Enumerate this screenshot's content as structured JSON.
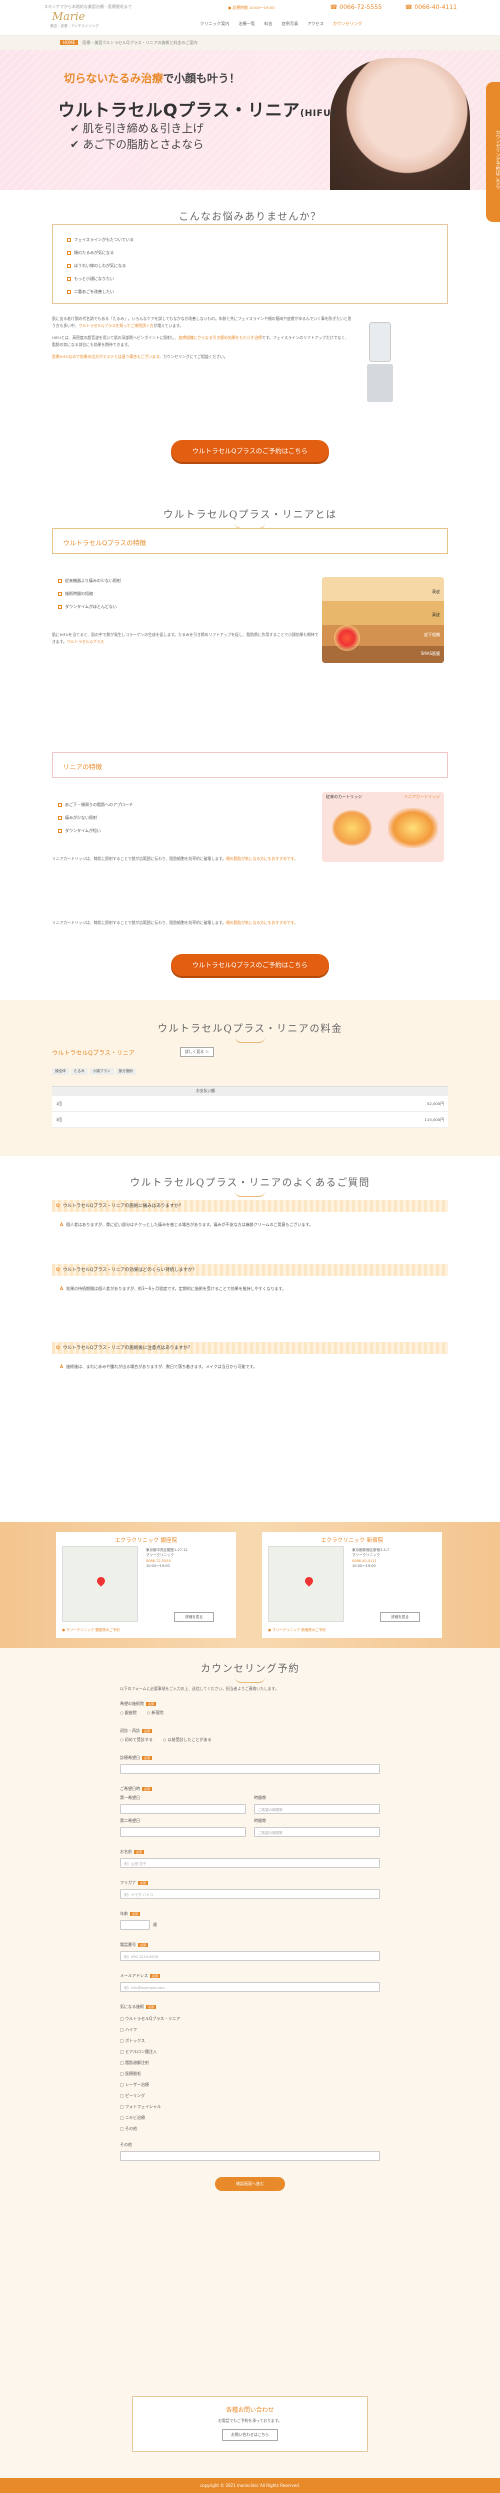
{
  "header": {
    "tagline": "スキンケアから本格的な美容治療・医療脱毛まで",
    "logo": "Marie",
    "logo_sub": "美容・皮膚・アンチエイジング",
    "hours": "● 診療時間 10:00〜19:00",
    "tel1": "☎ 0066-72-5555",
    "tel2": "☎ 0066-40-4111",
    "nav": [
      "クリニック案内",
      "治療一覧",
      "料金",
      "症例写真",
      "アクセス",
      "カウンセリング"
    ]
  },
  "breadcrumb": {
    "home": "HOME",
    "current": "医療・美容ウルトラセルQプラス・リニアの施術と料金のご案内"
  },
  "hero": {
    "line1a": "切らないたるみ治療",
    "line1b": "で小顔も叶う！",
    "title": "ウルトラセルQプラス・リニア",
    "title_suffix": "(HIFU)",
    "point1": "✔ 肌を引き締め＆引き上げ",
    "point2": "✔ あご下の脂肪とさよなら"
  },
  "side_tab": "カウンセリング予約はこちら",
  "worries": {
    "title": "こんなお悩みありませんか？",
    "items": [
      "フェイスラインがもたついている",
      "頬のたるみが気になる",
      "ほうれい線のしわが気になる",
      "もっと小顔になりたい",
      "二重あごを改善したい"
    ]
  },
  "intro": {
    "p1": "肌に出る老け顔の代名詞でもある「たるみ」。いろんなケアを試してもなかなか改善しないもの。年齢と共にフェイスラインや頬の筋肉や皮膚がゆるんでいく事を防ぎたいと思う方も多い中、",
    "p1o": "ウルトラセルQプラスを知ってご来院頂く方",
    "p1e": "が増えています。",
    "p2": "HIFUとは、高密度の超音波を用いて肌の深部層へピンポイントに照射し、",
    "p2o": "皮膚組織にさらなる引き締め効果をもたらす治療",
    "p2e": "です。",
    "p3": "フェイスラインのリフトアップだけでなく、脂肪の気になる部位にも効果を期待できます。",
    "p4o": "医療HIFUなので効果の出方がエステとは違う場合もございます。",
    "p4e": "カウンセリングにてご相談ください。"
  },
  "cta": "ウルトラセルQプラスのご予約はこちら",
  "about": {
    "title": "ウルトラセルQプラス・リニアとは",
    "feature1": "ウルトラセルQプラスの特徴",
    "f1items": [
      "従来機器より痛みの少ない照射",
      "施術時間の短縮",
      "ダウンタイムがほとんどない"
    ],
    "f1text": "肌にHIFUを当てると、肌の中で熱が発生しコラーゲンの生成を促します。たるみを引き締めリフトアップを促し、脂肪層に作用することで小顔効果も期待できます。",
    "f1o": "ウルトラセルQプラス",
    "layers": [
      "表皮",
      "真皮",
      "皮下組織",
      "SMAS筋膜"
    ],
    "feature2": "リニアの特徴",
    "f2items": [
      "あご下・頬周りの脂肪へのアプローチ",
      "痛みが少ない照射",
      "ダウンタイムが短い"
    ],
    "f2text": "リニアカートリッジは、線状に照射することで熱が広範囲に伝わり、脂肪細胞を効率的に破壊します。",
    "f2o": "頬の脂肪が気になる方にもおすすめです。",
    "cart_old": "従来のカートリッジ",
    "cart_new": "リニアカートリッジ"
  },
  "price": {
    "title": "ウルトラセルQプラス・リニアの料金",
    "subtitle": "ウルトラセルQプラス・リニア",
    "more": "詳しく見る ＞",
    "tabs": [
      "顔全体",
      "たるみ",
      "小顔プラン",
      "部分施術"
    ],
    "head": [
      "",
      "お支払い額"
    ],
    "rows": [
      [
        "1回",
        "52,000円"
      ],
      [
        "3回",
        "115,000円"
      ]
    ]
  },
  "faq": {
    "title": "ウルトラセルQプラス・リニアのよくあるご質問",
    "items": [
      {
        "q": "ウルトラセルQプラス・リニアの施術に痛みはありますか？",
        "a": "個人差はありますが、骨に近い部分はチクっとした痛みを感じる場合があります。痛みが不安な方は麻酔クリームのご用意もございます。"
      },
      {
        "q": "ウルトラセルQプラス・リニアの効果はどのくらい持続しますか？",
        "a": "効果の持続期間は個人差がありますが、約3〜6ヶ月程度です。定期的に施術を受けることで効果を維持しやすくなります。"
      },
      {
        "q": "ウルトラセルQプラス・リニアの施術後に注意点はありますか？",
        "a": "施術後は、まれに赤みや腫れが出る場合がありますが、数日で落ち着きます。メイクは当日から可能です。"
      }
    ]
  },
  "access": [
    {
      "title": "エクラクリニック 銀座院",
      "address": "東京都中央区銀座1-27-12",
      "name": "マリークリニック",
      "tel": "0066-72-5555",
      "hours": "10:00〜19:00",
      "btn": "詳細を見る",
      "foot": "● マリークリニック 銀座院のご予約"
    },
    {
      "title": "エクラクリニック 新宿院",
      "address": "東京都新宿区新宿3-5-7",
      "name": "マリークリニック",
      "tel": "0066-40-4111",
      "hours": "10:00〜19:00",
      "btn": "詳細を見る",
      "foot": "● マリークリニック 新宿院のご予約"
    }
  ],
  "form": {
    "title": "カウンセリング予約",
    "intro": "以下のフォームに必要事項をご入力の上、送信してください。担当者よりご連絡いたします。",
    "q1": "希望の施術院",
    "q1opts": [
      "銀座院",
      "新宿院"
    ],
    "q2": "初診・再診",
    "q2opts": [
      "初めて受診する",
      "以前受診したことがある"
    ],
    "q3": "診療希望日",
    "q4": "ご希望日時",
    "d1": "第一希望日",
    "d2": "第二希望日",
    "t": "時間帯",
    "tsel": "ご希望の時間帯",
    "name": "お名前",
    "name_ph": "例）山田 花子",
    "kana": "フリガナ",
    "kana_ph": "例）ヤマダ ハナコ",
    "age": "年齢",
    "age_unit": "歳",
    "tel": "電話番号",
    "tel_ph": "例）090-1234-5678",
    "mail": "メールアドレス",
    "mail_ph": "例）info@example.com",
    "interest": "気になる施術",
    "interest_opts": [
      "ウルトラセルQプラス・リニア",
      "ハイフ",
      "ボトックス",
      "ヒアルロン酸注入",
      "脂肪溶解注射",
      "医療脱毛",
      "レーザー治療",
      "ピーリング",
      "フォトフェイシャル",
      "ニキビ治療",
      "その他"
    ],
    "other": "その他",
    "submit": "確認画面へ進む",
    "box_title": "各種お問い合わせ",
    "box_text": "お電話でもご予約を承っております。",
    "box_btn": "お問い合わせはこちら"
  },
  "footer": "copyright © 2021 marieclinic All Rights Reserved."
}
